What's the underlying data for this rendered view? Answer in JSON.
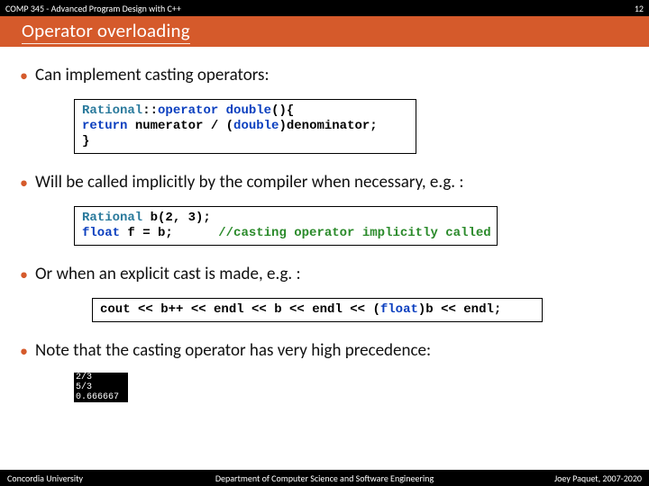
{
  "header": {
    "course": "COMP 345 - Advanced Program Design with C++",
    "page": "12"
  },
  "title": "Operator overloading",
  "bullets": {
    "b1": "Can implement casting operators:",
    "b2": "Will be called implicitly by the compiler when necessary, e.g. :",
    "b3": " Or when an explicit cast is made, e.g. :",
    "b4": "Note that the casting operator has very high precedence:"
  },
  "code1": {
    "t1": "Rational",
    "t2": "::",
    "t3": "operator",
    "t4": " ",
    "t5": "double",
    "t6": "(){",
    "t7": "return",
    "t8": " numerator / (",
    "t9": "double",
    "t10": ")denominator;",
    "t11": "}"
  },
  "code2": {
    "t1": "Rational",
    "t2": " b(2, 3);",
    "t3": "float",
    "t4": " f = b;      ",
    "t5": "//casting operator implicitly called"
  },
  "code3": {
    "t1": "cout << b++ << endl << b << endl << (",
    "t2": "float",
    "t3": ")b << endl;"
  },
  "console": "2/3\n5/3\n0.666667",
  "footer": {
    "left": "Concordia University",
    "mid": "Department of Computer Science and Software Engineering",
    "right": "Joey Paquet, 2007-2020"
  }
}
